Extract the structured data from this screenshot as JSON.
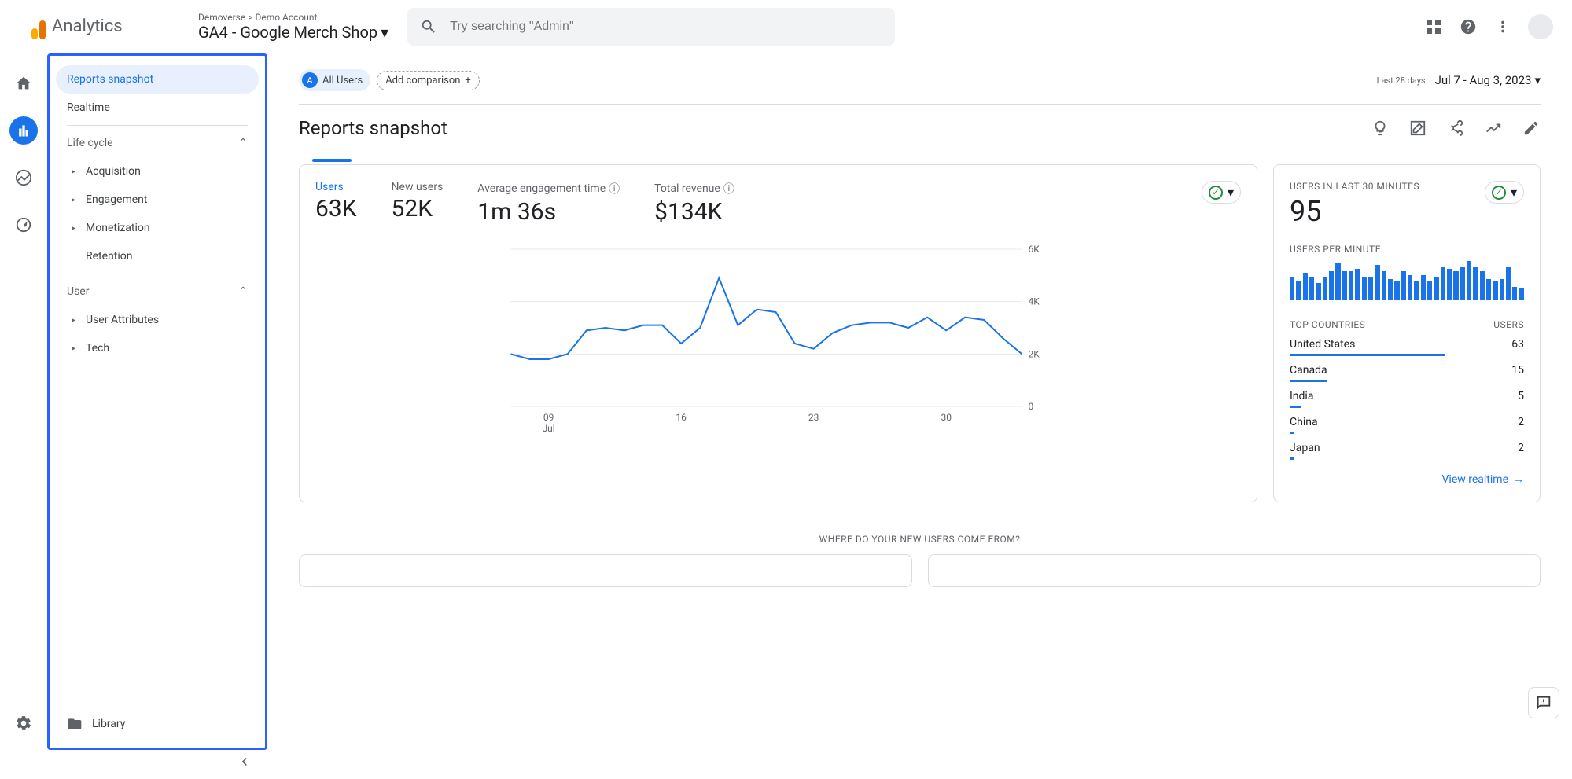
{
  "topbar": {
    "logo_text": "Analytics",
    "breadcrumb": "Demoverse > Demo Account",
    "property": "GA4 - Google Merch Shop",
    "search_placeholder": "Try searching \"Admin\""
  },
  "sidenav": {
    "items_top": [
      {
        "label": "Reports snapshot"
      },
      {
        "label": "Realtime"
      }
    ],
    "sections": [
      {
        "label": "Life cycle",
        "items": [
          "Acquisition",
          "Engagement",
          "Monetization",
          "Retention"
        ]
      },
      {
        "label": "User",
        "items": [
          "User Attributes",
          "Tech"
        ]
      }
    ],
    "library": "Library"
  },
  "header": {
    "segment_letter": "A",
    "segment": "All Users",
    "add_comparison": "Add comparison",
    "date_prefix": "Last 28 days",
    "date_range": "Jul 7 - Aug 3, 2023",
    "title": "Reports snapshot"
  },
  "metrics": [
    {
      "label": "Users",
      "value": "63K"
    },
    {
      "label": "New users",
      "value": "52K"
    },
    {
      "label": "Average engagement time",
      "value": "1m 36s",
      "help": true
    },
    {
      "label": "Total revenue",
      "value": "$134K",
      "help": true
    }
  ],
  "chart_data": {
    "type": "line",
    "xlabel": "",
    "ylabel": "",
    "ylim": [
      0,
      6000
    ],
    "yticks": [
      0,
      2000,
      4000,
      6000
    ],
    "ytick_labels": [
      "0",
      "2K",
      "4K",
      "6K"
    ],
    "x_tick_positions": [
      2,
      9,
      16,
      23
    ],
    "x_tick_labels": [
      "09\nJul",
      "16",
      "23",
      "30"
    ],
    "series": [
      {
        "name": "Users",
        "color": "#1a73e8",
        "values": [
          2000,
          1800,
          1800,
          2000,
          2900,
          3000,
          2900,
          3100,
          3100,
          2400,
          3000,
          4900,
          3100,
          3700,
          3600,
          2400,
          2200,
          2800,
          3100,
          3200,
          3200,
          3000,
          3400,
          2900,
          3400,
          3300,
          2600,
          2000
        ]
      }
    ]
  },
  "realtime": {
    "label": "Users in last 30 minutes",
    "value": "95",
    "upm_label": "Users per minute",
    "spark": [
      24,
      20,
      28,
      24,
      18,
      24,
      30,
      38,
      30,
      30,
      32,
      24,
      24,
      36,
      30,
      22,
      20,
      30,
      26,
      20,
      26,
      20,
      24,
      34,
      32,
      30,
      34,
      40,
      34,
      30,
      22,
      20,
      22,
      34,
      14,
      12
    ],
    "countries_h1": "Top countries",
    "countries_h2": "Users",
    "countries": [
      {
        "name": "United States",
        "value": "63",
        "pct": 66
      },
      {
        "name": "Canada",
        "value": "15",
        "pct": 16
      },
      {
        "name": "India",
        "value": "5",
        "pct": 5
      },
      {
        "name": "China",
        "value": "2",
        "pct": 2
      },
      {
        "name": "Japan",
        "value": "2",
        "pct": 2
      }
    ],
    "link": "View realtime"
  },
  "next_section": "Where do your new users come from?"
}
